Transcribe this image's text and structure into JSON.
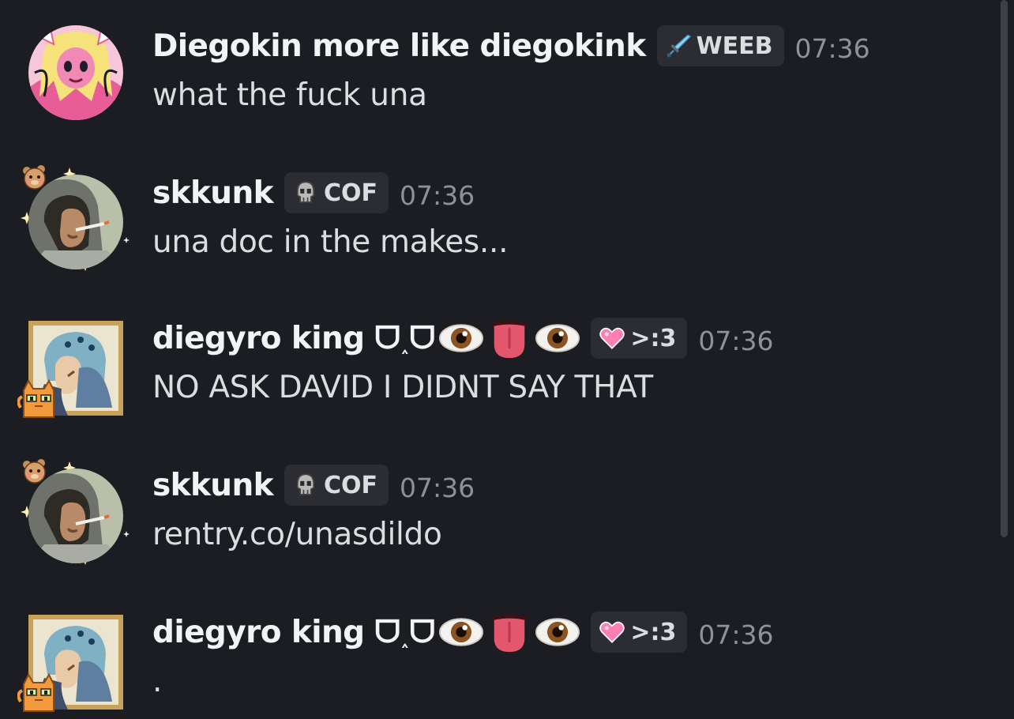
{
  "channel": {
    "messages": [
      {
        "author": "Diegokin more like diegokink",
        "tag_icon": "sword-icon",
        "tag": "WEEB",
        "timestamp": "07:36",
        "text": "what the fuck una",
        "avatar": "pink-anime-avatar"
      },
      {
        "author": "skkunk",
        "tag_icon": "skull-icon",
        "tag": "COF",
        "timestamp": "07:36",
        "text": "una doc in the makes...",
        "avatar": "hooded-smoker-avatar"
      },
      {
        "author": "diegyro king ᗜ˰ᗜ",
        "author_emojis": [
          "eye-emoji",
          "tongue-emoji",
          "eye-emoji"
        ],
        "tag_icon": "pink-heart-icon",
        "tag": ">:3",
        "timestamp": "07:36",
        "text": "NO ASK DAVID I DIDNT SAY THAT",
        "avatar": "jojo-knight-avatar"
      },
      {
        "author": "skkunk",
        "tag_icon": "skull-icon",
        "tag": "COF",
        "timestamp": "07:36",
        "text": "rentry.co/unasdildo",
        "avatar": "hooded-smoker-avatar"
      },
      {
        "author": "diegyro king ᗜ˰ᗜ",
        "author_emojis": [
          "eye-emoji",
          "tongue-emoji",
          "eye-emoji"
        ],
        "tag_icon": "pink-heart-icon",
        "tag": ">:3",
        "timestamp": "07:36",
        "text": ".",
        "avatar": "jojo-knight-avatar"
      }
    ]
  },
  "colors": {
    "background": "#1c1d22",
    "username": "#f2f3f5",
    "message_text": "#dbdee1",
    "timestamp": "#8e9297",
    "tag_background": "#2b2d33"
  }
}
